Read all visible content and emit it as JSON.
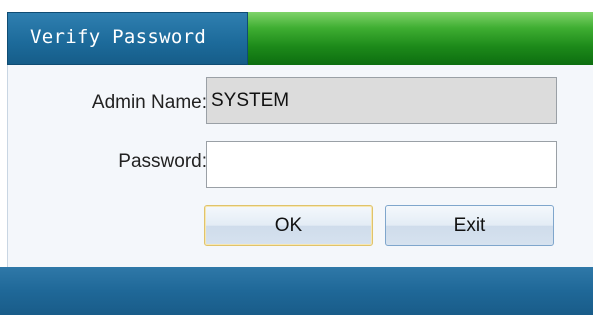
{
  "dialog": {
    "title": "Verify Password",
    "admin_label": "Admin Name:",
    "admin_value": "SYSTEM",
    "password_label": "Password:",
    "password_value": "",
    "ok_label": "OK",
    "exit_label": "Exit"
  },
  "colors": {
    "title_tab": "#1c6a9a",
    "title_fill": "#1d8a1a",
    "content_bg": "#f4f7fb",
    "admin_field_bg": "#dcdcdc",
    "bottom_bar": "#1f6898",
    "ok_border": "#e0c36a"
  }
}
